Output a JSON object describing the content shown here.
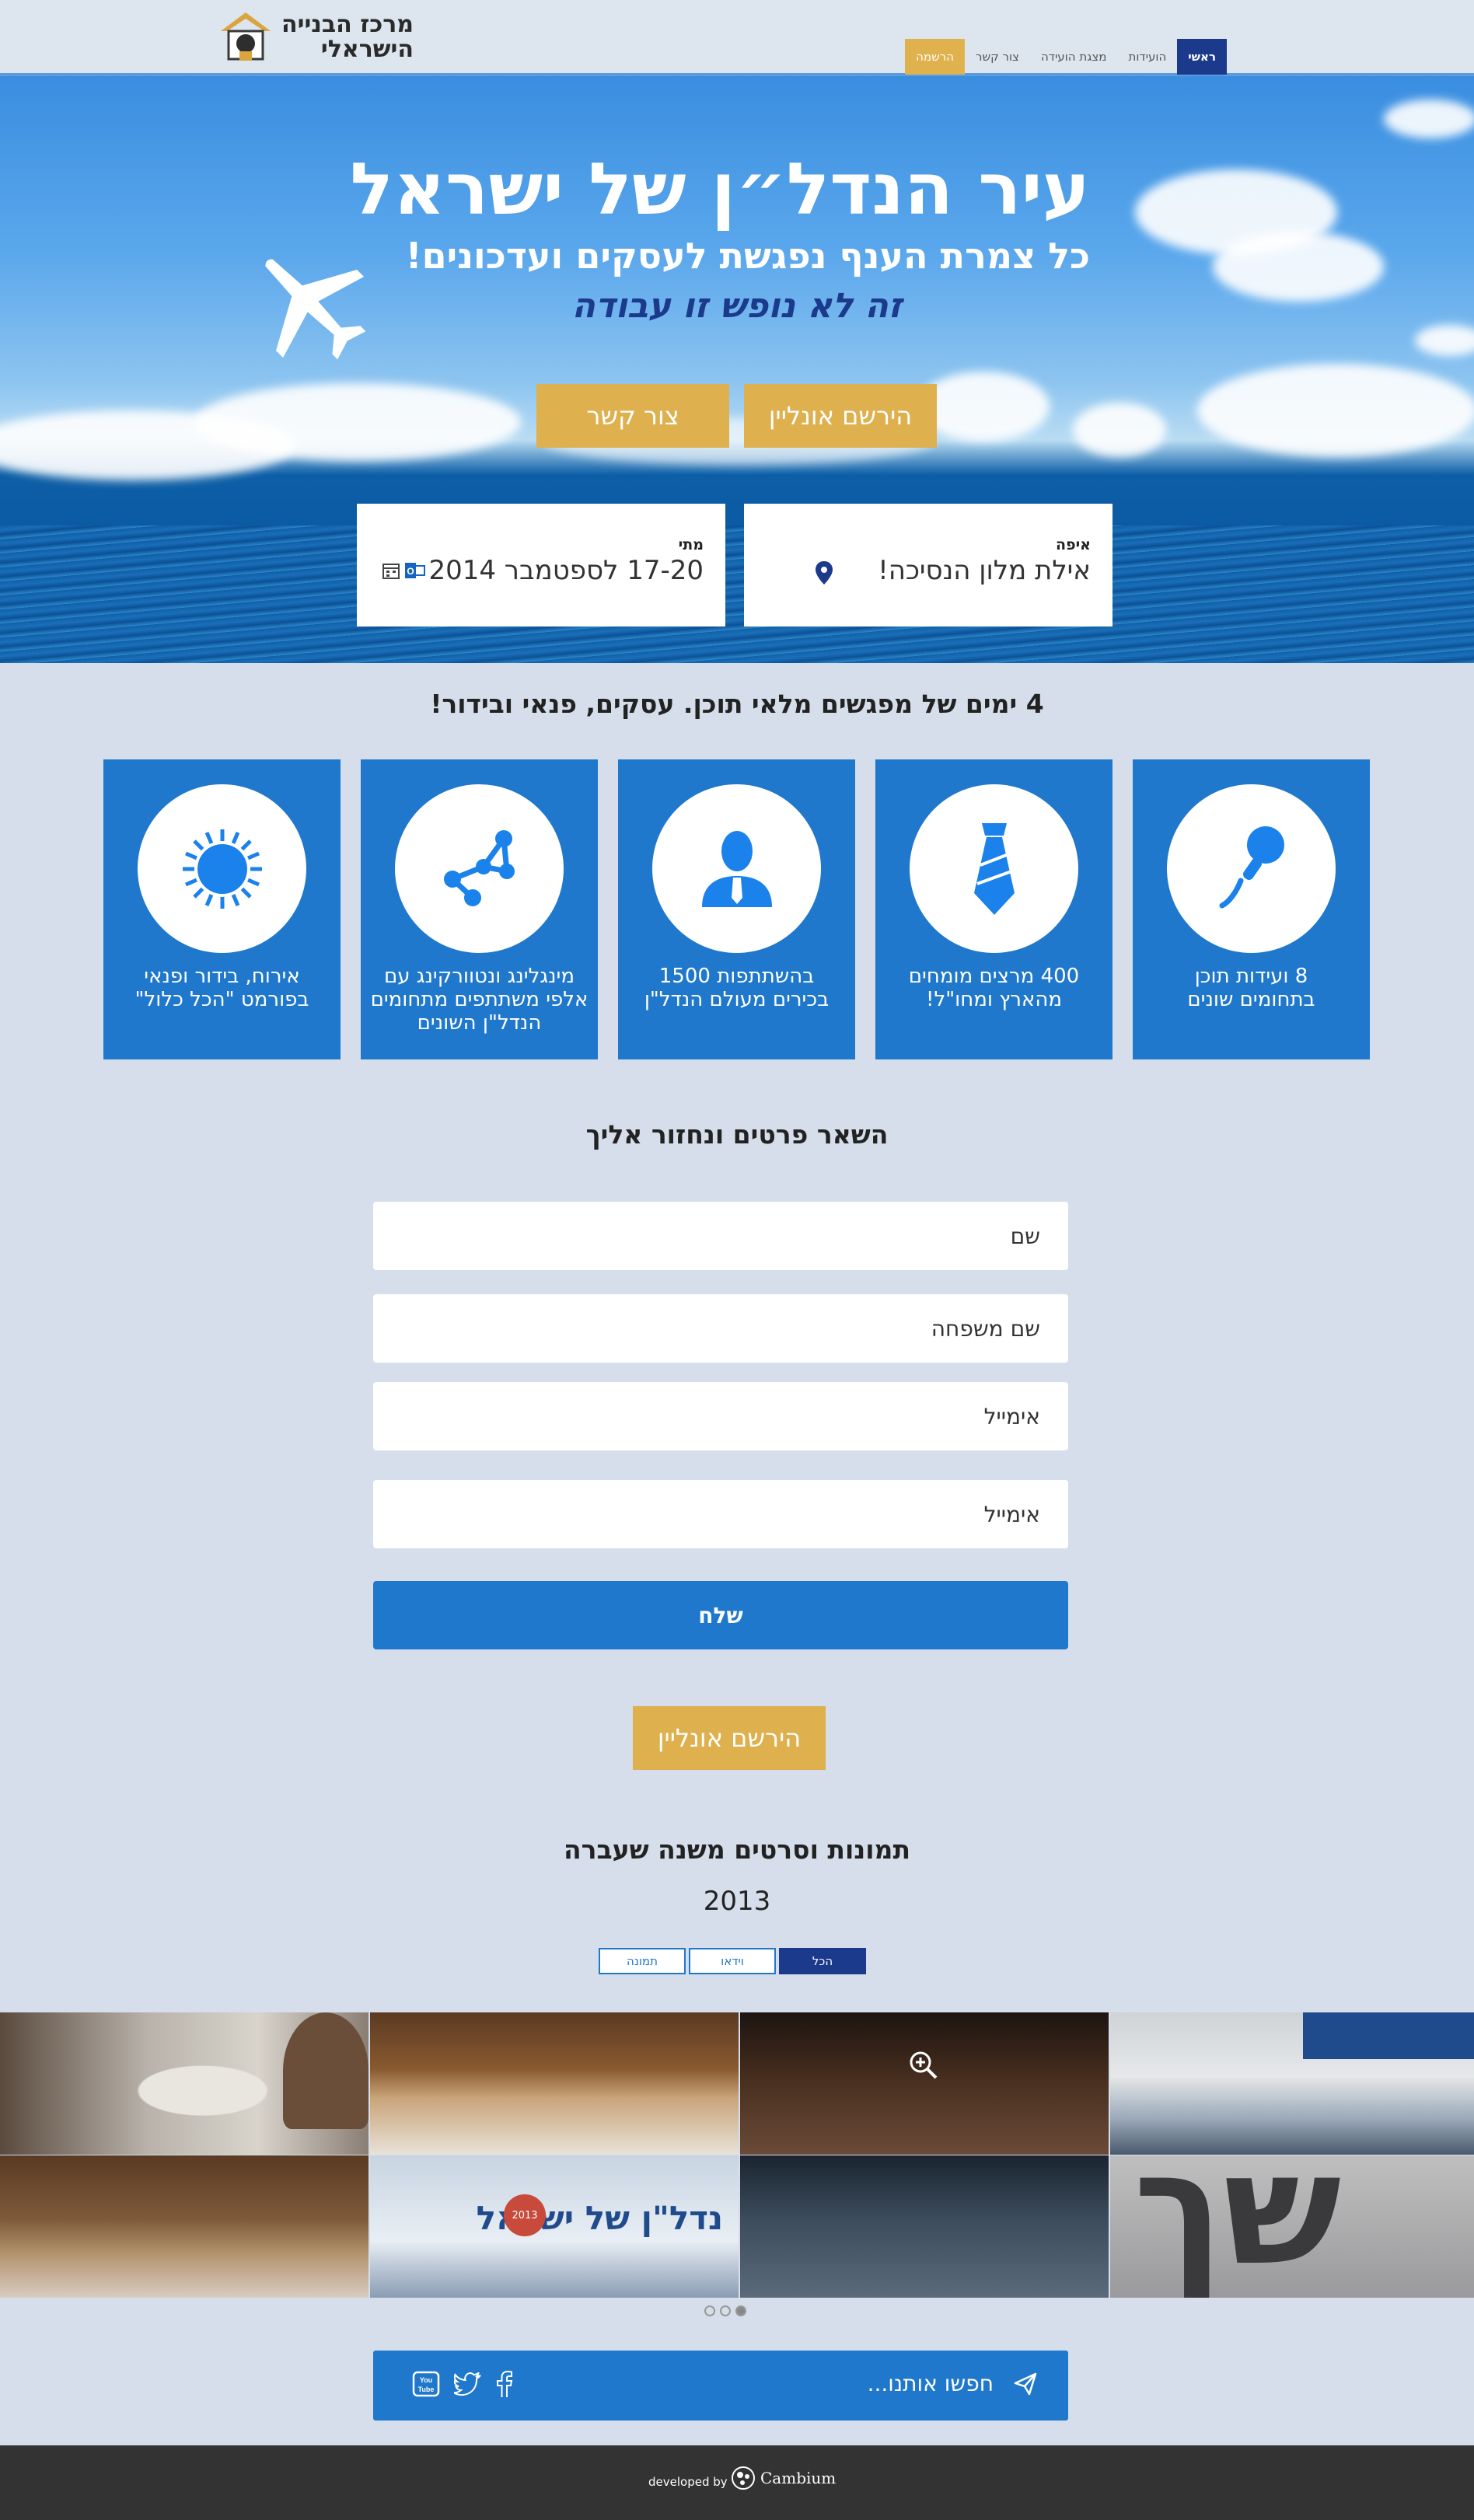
{
  "header": {
    "logo_line1": "מרכז הבנייה",
    "logo_line2": "הישראלי",
    "nav": [
      {
        "label": "ראשי"
      },
      {
        "label": "הועידות"
      },
      {
        "label": "מצגת הועידה"
      },
      {
        "label": "צור קשר"
      },
      {
        "label": "הרשמה"
      }
    ]
  },
  "hero": {
    "title": "עיר הנדל״ן של ישראל",
    "subtitle": "כל צמרת הענף נפגשת לעסקים ועדכונים!",
    "tagline": "זה לא נופש זו עבודה",
    "register_button": "הירשם אונליין",
    "contact_button": "צור קשר",
    "where_label": "איפה",
    "where_value": "אילת מלון הנסיכה!",
    "when_label": "מתי",
    "when_value": "17-20 לספטמבר 2014"
  },
  "features": {
    "title": "4 ימים של מפגשים מלאי תוכן. עסקים, פנאי ובידור!",
    "items": [
      {
        "text": "8 ועידות תוכן\nבתחומים שונים",
        "icon": "microphone-icon"
      },
      {
        "text": "400 מרצים מומחים\nמהארץ ומחו\"ל!",
        "icon": "tie-icon"
      },
      {
        "text": "בהשתתפות 1500\nבכירים מעולם הנדל\"ן",
        "icon": "person-icon"
      },
      {
        "text": "מינגלינג ונטוורקינג עם\nאלפי משתתפים מתחומים\nהנדל\"ן השונים",
        "icon": "network-icon"
      },
      {
        "text": "אירוח, בידור ופנאי\nבפורמט \"הכל כלול\"",
        "icon": "sun-icon"
      }
    ]
  },
  "form": {
    "title": "השאר פרטים ונחזור אליך",
    "first_name_placeholder": "שם",
    "last_name_placeholder": "שם משפחה",
    "email_placeholder": "אימייל",
    "email2_placeholder": "אימייל",
    "send_label": "שלח",
    "register_button": "הירשם אונליין"
  },
  "gallery": {
    "title": "תמונות וסרטים משנה שעברה",
    "year": "2013",
    "filters": [
      {
        "label": "הכל"
      },
      {
        "label": "וידאו"
      },
      {
        "label": "תמונה"
      }
    ],
    "tile_banner_text": "נדל\"ן של ישראל",
    "tile_badge_text": "2013"
  },
  "social": {
    "text": "חפשו אותנו...",
    "icons": [
      "youtube-icon",
      "twitter-icon",
      "facebook-icon"
    ]
  },
  "footer": {
    "developed_by": "developed by",
    "brand": "Cambium"
  }
}
